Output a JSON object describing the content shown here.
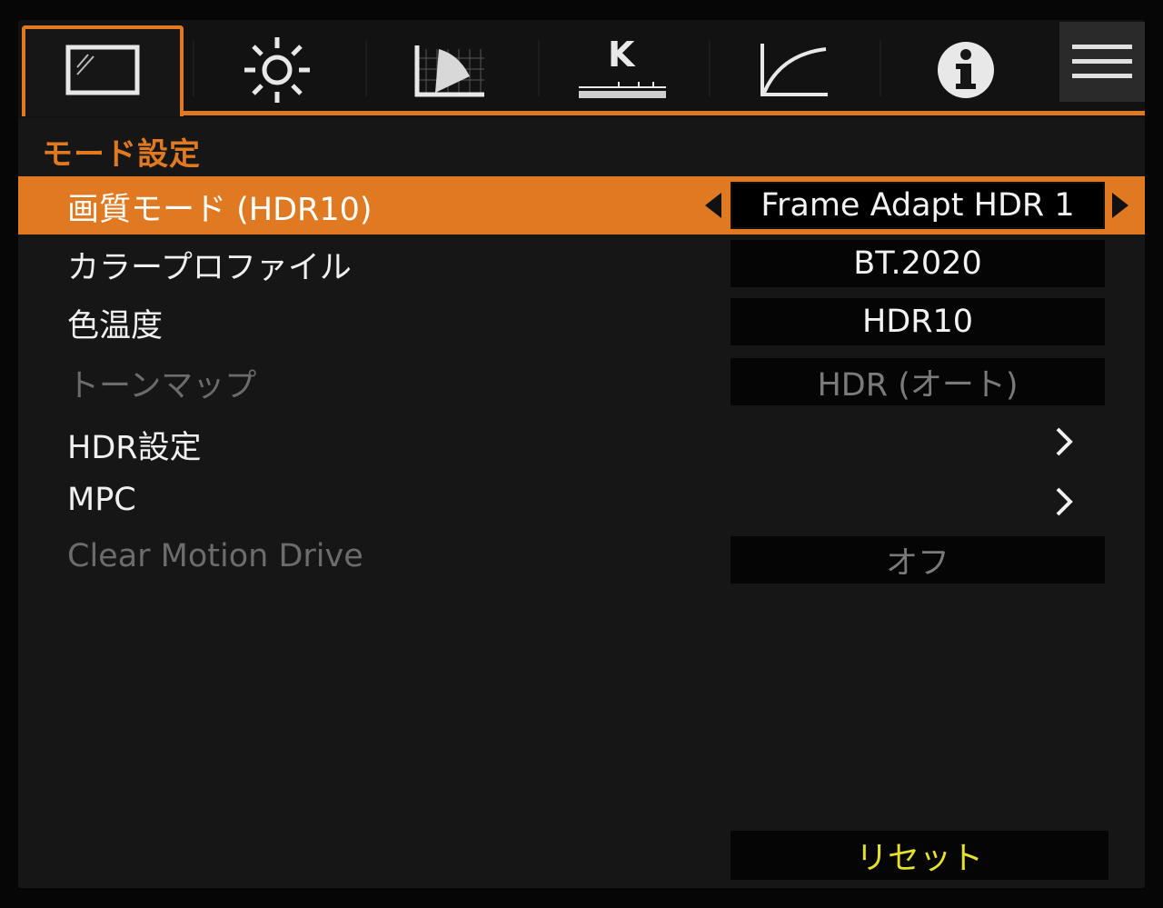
{
  "tabs": [
    {
      "icon": "picture-mode-icon",
      "active": true
    },
    {
      "icon": "brightness-icon",
      "active": false
    },
    {
      "icon": "color-gamut-icon",
      "active": false
    },
    {
      "icon": "color-temperature-k-icon",
      "active": false
    },
    {
      "icon": "gamma-curve-icon",
      "active": false
    },
    {
      "icon": "info-icon",
      "active": false
    },
    {
      "icon": "menu-icon",
      "active": false
    }
  ],
  "tab_k_label": "K",
  "section_title": "モード設定",
  "rows": [
    {
      "label": "画質モード (HDR10)",
      "value": "Frame Adapt HDR 1",
      "state": "selected"
    },
    {
      "label": "カラープロファイル",
      "value": "BT.2020",
      "state": "normal"
    },
    {
      "label": "色温度",
      "value": "HDR10",
      "state": "normal"
    },
    {
      "label": "トーンマップ",
      "value": "HDR (オート)",
      "state": "disabled"
    },
    {
      "label": "HDR設定",
      "value": "",
      "state": "submenu"
    },
    {
      "label": "MPC",
      "value": "",
      "state": "submenu"
    },
    {
      "label": "Clear Motion Drive",
      "value": "オフ",
      "state": "disabled"
    }
  ],
  "reset_label": "リセット",
  "colors": {
    "accent": "#e07a22",
    "reset_text": "#e6e22a",
    "disabled_text": "#6c6c6c"
  }
}
